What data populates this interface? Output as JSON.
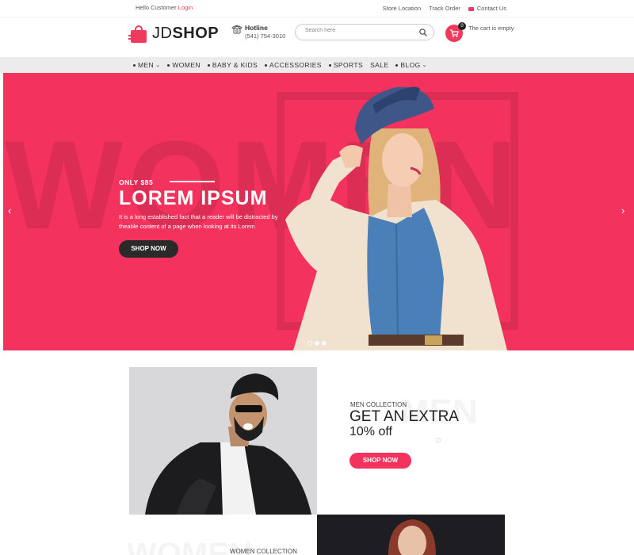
{
  "topbar": {
    "greeting": "Hello Customer",
    "login": "Login",
    "links": [
      "Store Location",
      "Track Order",
      "Contact Us"
    ]
  },
  "header": {
    "logo": {
      "jd": "JD",
      "shop": "SHOP"
    },
    "hotline": {
      "label": "Hotline",
      "phone": "(541) 754-3010"
    },
    "search": {
      "placeholder": "Search here"
    },
    "cart": {
      "count": "0",
      "text": "The cart is empty"
    }
  },
  "nav": {
    "items": [
      {
        "label": "MEN",
        "dot": true,
        "dropdown": true
      },
      {
        "label": "WOMEN",
        "dot": true,
        "dropdown": false
      },
      {
        "label": "BABY & KIDS",
        "dot": true,
        "dropdown": false
      },
      {
        "label": "ACCESSORIES",
        "dot": true,
        "dropdown": false
      },
      {
        "label": "SPORTS",
        "dot": true,
        "dropdown": false
      },
      {
        "label": "SALE",
        "dot": false,
        "dropdown": false
      },
      {
        "label": "BLOG",
        "dot": true,
        "dropdown": true
      }
    ]
  },
  "hero": {
    "bg_word": "WOMEN",
    "price": "ONLY $85",
    "title": "LOREM IPSUM",
    "description": "It is a long established fact that a reader will be distracted by theable content of a page when looking at its Lorem",
    "button": "SHOP NOW",
    "slides": 3,
    "active_slide": 1
  },
  "men_collection": {
    "bg_word": "MEN",
    "label": "MEN COLLECTION",
    "heading": "GET AN EXTRA",
    "offer": "10% off",
    "button": "SHOP NOW"
  },
  "women_collection": {
    "bg_word": "WOMEN",
    "label": "WOMEN COLLECTION"
  },
  "colors": {
    "accent": "#f3325d",
    "dark": "#2a2a2a",
    "nav_bg": "#ececec"
  }
}
